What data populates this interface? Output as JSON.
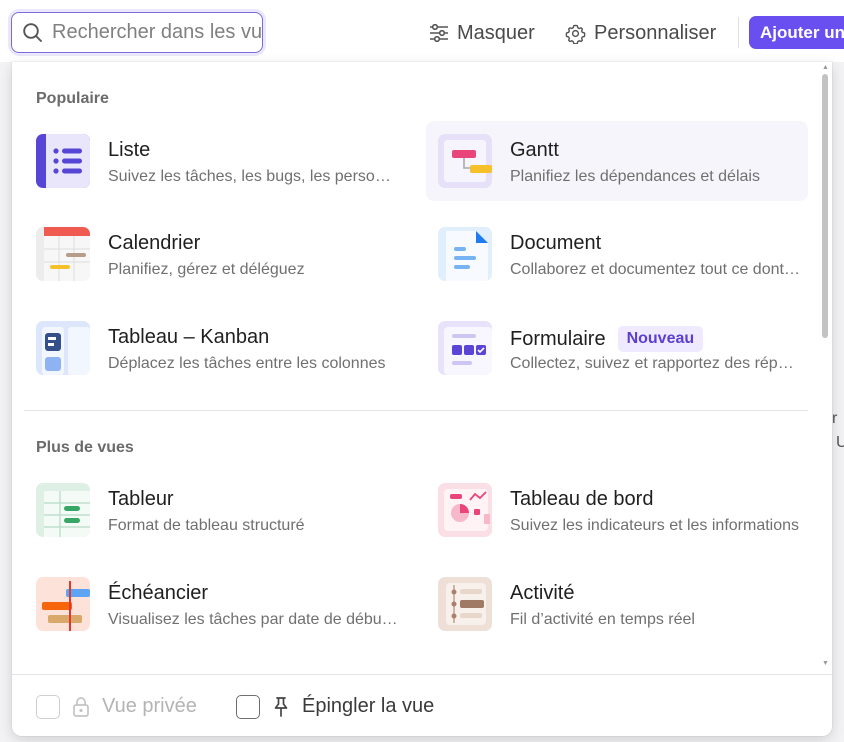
{
  "toolbar": {
    "search_placeholder": "Rechercher dans les vues",
    "hide_label": "Masquer",
    "customize_label": "Personnaliser",
    "add_label": "Ajouter une tâche"
  },
  "background": {
    "peek_1": "r",
    "peek_2": "U"
  },
  "sections": {
    "popular": {
      "title": "Populaire",
      "items": [
        {
          "title": "Liste",
          "desc": "Suivez les tâches, les bugs, les personnes et plus"
        },
        {
          "title": "Gantt",
          "desc": "Planifiez les dépendances et délais"
        },
        {
          "title": "Calendrier",
          "desc": "Planifiez, gérez et déléguez"
        },
        {
          "title": "Document",
          "desc": "Collaborez et documentez tout ce dont vous avez besoin"
        },
        {
          "title": "Tableau – Kanban",
          "desc": "Déplacez les tâches entre les colonnes"
        },
        {
          "title": "Formulaire",
          "desc": "Collectez, suivez et rapportez des réponses",
          "badge": "Nouveau"
        }
      ]
    },
    "more": {
      "title": "Plus de vues",
      "items": [
        {
          "title": "Tableur",
          "desc": "Format de tableau structuré"
        },
        {
          "title": "Tableau de bord",
          "desc": "Suivez les indicateurs et les informations"
        },
        {
          "title": "Échéancier",
          "desc": "Visualisez les tâches par date de début et de fin"
        },
        {
          "title": "Activité",
          "desc": "Fil d’activité en temps réel"
        }
      ]
    }
  },
  "footer": {
    "private_label": "Vue privée",
    "pin_label": "Épingler la vue"
  },
  "colors": {
    "accent": "#6a4ff0",
    "badge_bg": "#efeaff",
    "badge_text": "#5b3fd0"
  },
  "icons": {
    "search": "search-icon",
    "hide": "sliders-icon",
    "customize": "gear-icon",
    "lock": "lock-icon",
    "pin": "pin-icon"
  }
}
